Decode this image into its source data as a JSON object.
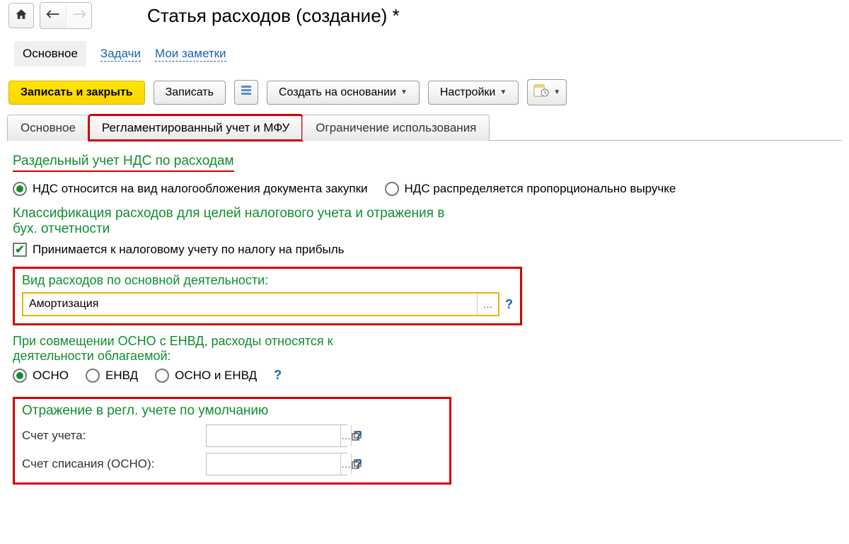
{
  "header": {
    "title": "Статья расходов (создание) *"
  },
  "top_tabs": {
    "active": "Основное",
    "links": [
      "Задачи",
      "Мои заметки"
    ]
  },
  "toolbar": {
    "save_close": "Записать и закрыть",
    "save": "Записать",
    "create_based": "Создать на основании",
    "settings": "Настройки"
  },
  "tabs2": {
    "t1": "Основное",
    "t2": "Регламентированный учет и МФУ",
    "t3": "Ограничение использования"
  },
  "vat_split": {
    "title": "Раздельный учет НДС по расходам",
    "opt1": "НДС относится на вид налогообложения документа закупки",
    "opt2": "НДС распределяется пропорционально выручке"
  },
  "classification": {
    "title": "Классификация расходов для целей налогового учета и отражения в бух. отчетности",
    "check": "Принимается к налоговому учету по налогу на прибыль"
  },
  "main_expense": {
    "label": "Вид расходов по основной деятельности:",
    "value": "Амортизация"
  },
  "osno_note": "При совмещении ОСНО с ЕНВД, расходы относятся к деятельности облагаемой:",
  "osno_radio": {
    "o1": "ОСНО",
    "o2": "ЕНВД",
    "o3": "ОСНО и ЕНВД"
  },
  "default_reg": {
    "title": "Отражение в регл. учете по умолчанию",
    "acct_label": "Счет учета:",
    "writeoff_label": "Счет списания (ОСНО):"
  }
}
